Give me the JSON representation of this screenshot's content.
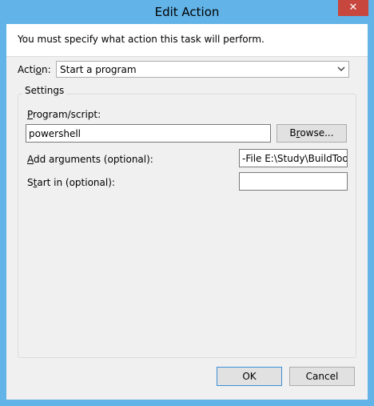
{
  "window": {
    "title": "Edit Action",
    "close_glyph": "✕"
  },
  "info": {
    "text": "You must specify what action this task will perform."
  },
  "action": {
    "label_pre": "Acti",
    "label_key": "o",
    "label_post": "n:",
    "selected": "Start a program"
  },
  "settings": {
    "legend": "Settings",
    "program": {
      "label_key": "P",
      "label_post": "rogram/script:",
      "value": "powershell"
    },
    "browse": {
      "label_pre": "B",
      "label_key": "r",
      "label_post": "owse..."
    },
    "arguments": {
      "label_key": "A",
      "label_post": "dd arguments (optional):",
      "value": "-File E:\\Study\\BuildTools\\"
    },
    "start_in": {
      "label_pre": "S",
      "label_key": "t",
      "label_post": "art in (optional):",
      "value": ""
    }
  },
  "buttons": {
    "ok": "OK",
    "cancel": "Cancel"
  },
  "colors": {
    "titlebar": "#62b3e8",
    "close": "#c7463d",
    "client": "#f0f0f0"
  }
}
